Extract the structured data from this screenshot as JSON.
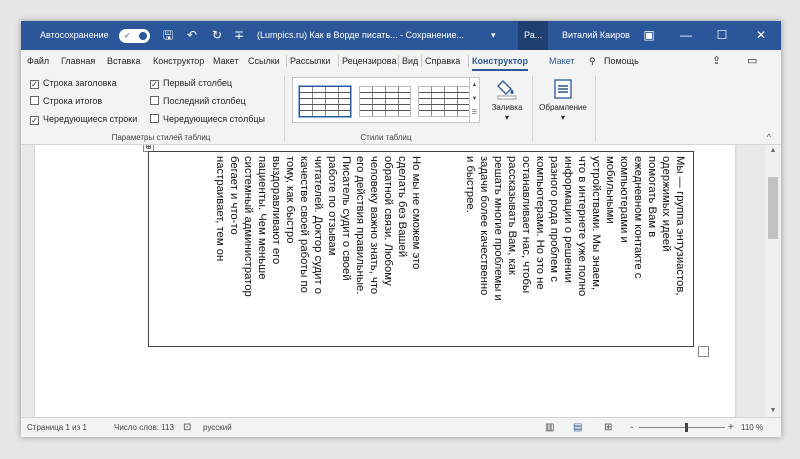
{
  "titlebar": {
    "autosave_label": "Автосохранение",
    "autosave_state": "●",
    "save_icon": "save-icon",
    "undo_icon": "↶",
    "redo_icon": "↻",
    "customize_icon": "∓",
    "doc_title": "(Lumpics.ru) Как в Ворде писать... - Сохранение...",
    "title_dropdown": "▾",
    "context_tab": "Ра...",
    "user": "Виталий Каиров",
    "ribbon_display_icon": "▣",
    "minimize": "—",
    "maximize": "☐",
    "close": "✕"
  },
  "tabs": [
    "Файл",
    "Главная",
    "Вставка",
    "Конструктор",
    "Макет",
    "Ссылки",
    "Рассылки",
    "Рецензирова",
    "Вид",
    "Справка",
    "Конструктор",
    "Макет",
    "Помощь"
  ],
  "tab_help_icon": "⚲",
  "share_icon": "⇪",
  "comment_icon": "▭",
  "ribbon": {
    "options": [
      {
        "label": "Строка заголовка",
        "checked": "✓"
      },
      {
        "label": "Строка итогов",
        "checked": ""
      },
      {
        "label": "Чередующиеся строки",
        "checked": "✓"
      },
      {
        "label": "Первый столбец",
        "checked": "✓"
      },
      {
        "label": "Последний столбец",
        "checked": ""
      },
      {
        "label": "Чередующиеся столбцы",
        "checked": ""
      }
    ],
    "group_options": "Параметры стилей таблиц",
    "group_styles": "Стили таблиц",
    "shading": "Заливка",
    "shading_arrow": "▾",
    "borders": "Обрамление",
    "borders_arrow": "▾",
    "collapse": "^",
    "scroll_up": "▲",
    "scroll_down": "▼",
    "scroll_more": "☰"
  },
  "document": {
    "cell1": "Мы — группа энтузиастов,\nодержимых идеей\nпомогать Вам в\nежедневном контакте с\nкомпьютерами и\nмобильными\nустройствами. Мы знаем,\nчто в интернете уже полно\nинформации о решении\nразного рода проблем с\nкомпьютерами. Но это не\nостанавливает нас, чтобы\nрассказывать Вам, как\nрешать многие проблемы и\nзадачи более качественно\nи быстрее.",
    "cell2": "Но мы не сможем это\nсделать без Вашей\nобратной связи. Любому\nчеловеку важно знать, что\nего действия правильные.\nПисатель судит о своей\nработе по отзывам\nчитателей. Доктор судит о\nкачестве своей работы по\nтому, как быстро\nвыздоравливают его\nпациенты. Чем меньше\nсистемный администратор\nбегает и что-то\nнастраивает, тем он",
    "table_move_handle": "⊕"
  },
  "scrollbar": {
    "up": "▲",
    "down": "▼"
  },
  "status": {
    "page": "Страница 1 из 1",
    "words": "Число слов: 113",
    "proofing_icon": "⊡",
    "language": "русский",
    "view_read": "▥",
    "view_print": "▤",
    "view_web": "⊞",
    "zoom_minus": "-",
    "zoom_plus": "+",
    "zoom": "110 %",
    "zoom_fraction": 0.55
  }
}
